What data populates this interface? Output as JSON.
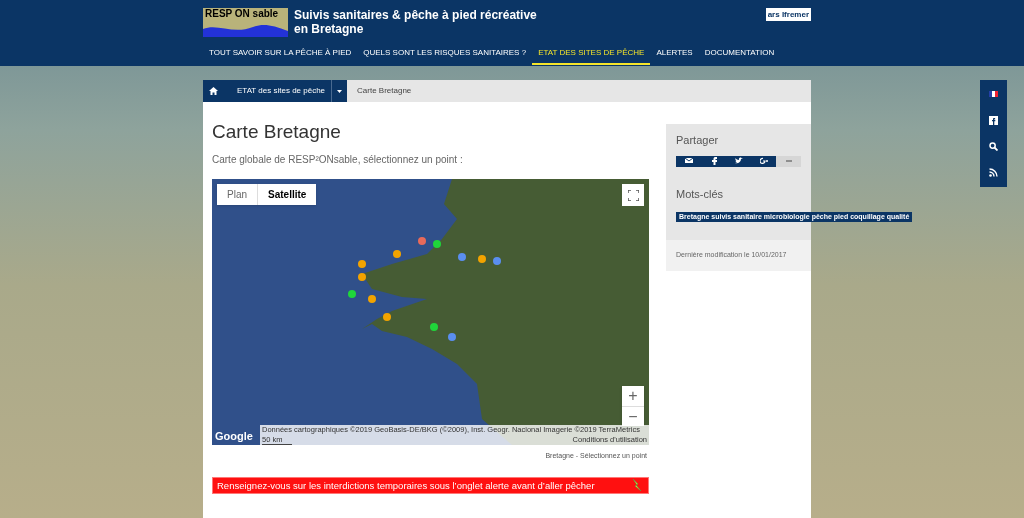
{
  "header": {
    "logo_text": "RESP ON sable",
    "title": "Suivis sanitaires & pêche à pied récréative en Bretagne",
    "partner_logo": "ars Ifremer"
  },
  "nav": [
    {
      "label": "TOUT SAVOIR SUR LA PÊCHE À PIED",
      "selected": false
    },
    {
      "label": "QUELS SONT LES RISQUES SANITAIRES ?",
      "selected": false
    },
    {
      "label": "ETAT DES SITES DE PÊCHE",
      "selected": true
    },
    {
      "label": "ALERTES",
      "selected": false
    },
    {
      "label": "DOCUMENTATION",
      "selected": false
    }
  ],
  "breadcrumb": {
    "items": [
      "ETAT des sites de pêche"
    ],
    "current": "Carte Bretagne"
  },
  "page": {
    "title": "Carte Bretagne",
    "intro": "Carte globale de RESP²ONsable, sélectionnez un point :"
  },
  "map": {
    "types": [
      {
        "label": "Plan",
        "selected": false
      },
      {
        "label": "Satellite",
        "selected": true
      }
    ],
    "attribution": "Données cartographiques ©2019 GeoBasis-DE/BKG (©2009), Inst. Geogr. Nacional Imagerie ©2019 TerraMetrics",
    "scale": "50 km",
    "terms": "Conditions d'utilisation",
    "brand": "Google",
    "zoom_in": "+",
    "zoom_out": "−"
  },
  "map_caption": "Bretagne - Sélectionnez un point",
  "alert_banner": "Renseignez-vous sur les interdictions temporaires sous l’onglet alerte avant d’aller pêcher",
  "sidebar": {
    "share_title": "Partager",
    "keywords_title": "Mots-clés",
    "keywords": "Bretagne suivis sanitaire microbiologie pêche pied coquillage qualité",
    "modified": "Dernière modification le 10/01/2017"
  }
}
